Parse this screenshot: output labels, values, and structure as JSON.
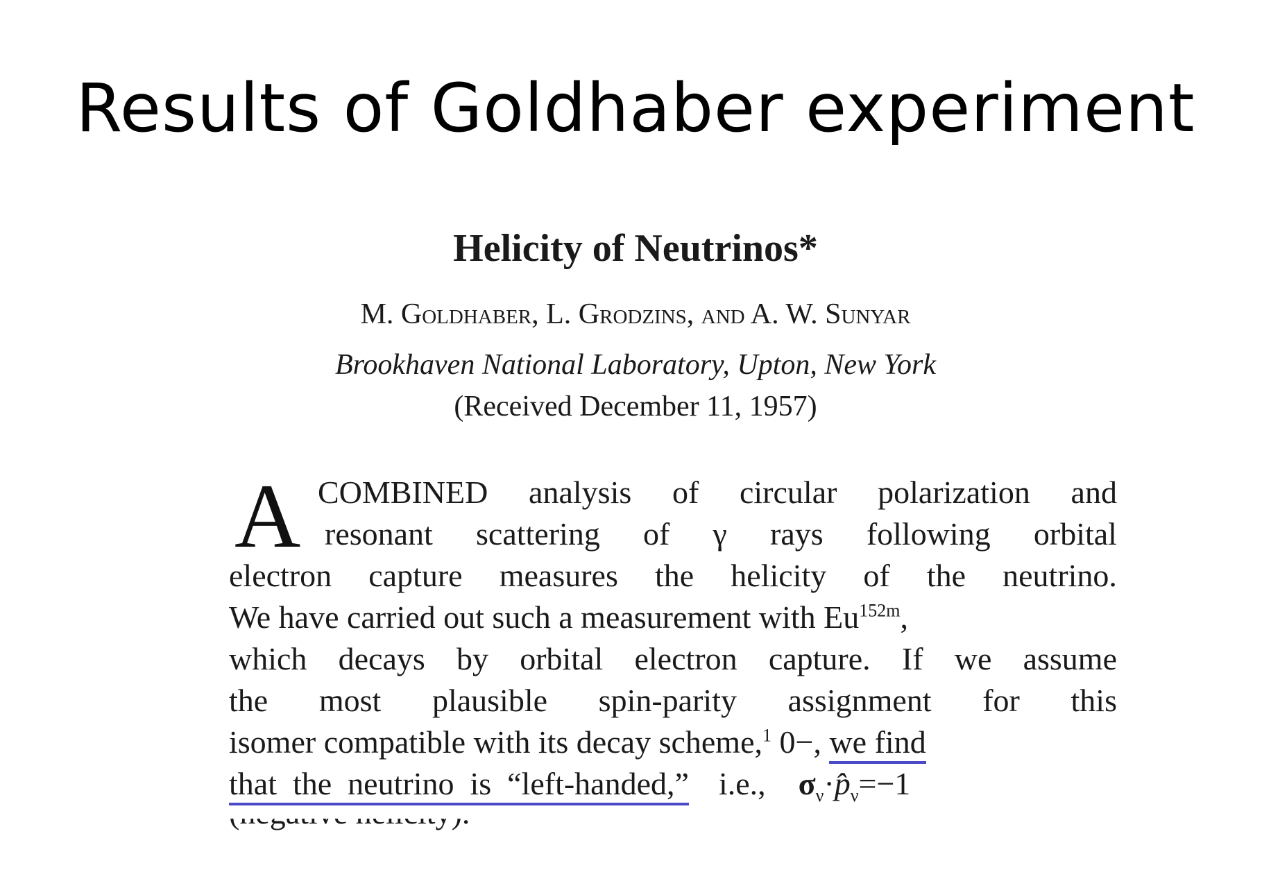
{
  "slide": {
    "title": "Results of Goldhaber experiment"
  },
  "paper": {
    "title": "Helicity of Neutrinos*",
    "authors": "M. Goldhaber, L. Grodzins, and A. W. Sunyar",
    "affiliation": "Brookhaven National Laboratory, Upton, New York",
    "received": "(Received December 11, 1957)"
  },
  "abstract": {
    "drop_cap": "A",
    "line1": [
      "COMBINED",
      "analysis",
      "of",
      "circular",
      "polarization",
      "and"
    ],
    "line2": [
      "resonant",
      "scattering",
      "of",
      "γ",
      "rays",
      "following",
      "orbital"
    ],
    "line3": [
      "electron",
      "capture",
      "measures",
      "the",
      "helicity",
      "of",
      "the",
      "neutrino."
    ],
    "line4_prefix": "We have carried out such a measurement with Eu",
    "line4_sup": "152m",
    "line4_suffix": ",",
    "line5": [
      "which",
      "decays",
      "by",
      "orbital",
      "electron",
      "capture.",
      "If",
      "we",
      "assume"
    ],
    "line6": [
      "the",
      "most",
      "plausible",
      "spin-parity",
      "assignment",
      "for",
      "this"
    ],
    "line7_prefix": "isomer compatible with its decay scheme,",
    "line7_sup": "1",
    "line7_mid": " 0−, ",
    "line7_underlined": "we find",
    "line8_underlined": "that  the  neutrino  is  “left-handed,”",
    "line8_ie": "i.e.,",
    "line8_sigma": "σ",
    "line8_nu_sub": "ν",
    "line8_dot": "·",
    "line8_phat": "p̂",
    "line8_rest": "=−1",
    "line9_partial": "(negative helicity)."
  },
  "colors": {
    "underline": "#4a4ac8",
    "text": "#1a1a1a"
  }
}
